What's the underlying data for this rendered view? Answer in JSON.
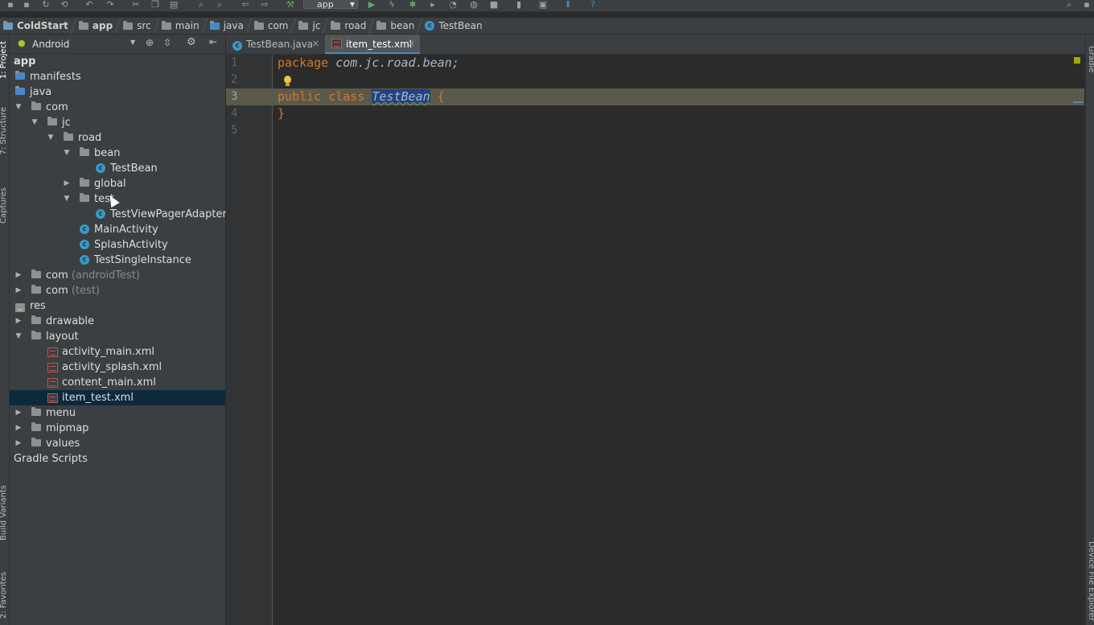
{
  "toolbar": {
    "run_config": "app"
  },
  "breadcrumb": [
    {
      "label": "ColdStart",
      "icon": "project-icon",
      "bold": true
    },
    {
      "label": "app",
      "icon": "module-folder-icon",
      "bold": true
    },
    {
      "label": "src",
      "icon": "folder-icon"
    },
    {
      "label": "main",
      "icon": "folder-icon"
    },
    {
      "label": "java",
      "icon": "source-folder-icon"
    },
    {
      "label": "com",
      "icon": "package-icon"
    },
    {
      "label": "jc",
      "icon": "package-icon"
    },
    {
      "label": "road",
      "icon": "package-icon"
    },
    {
      "label": "bean",
      "icon": "package-icon"
    },
    {
      "label": "TestBean",
      "icon": "class-icon"
    }
  ],
  "project_panel": {
    "view_mode": "Android"
  },
  "tree": [
    {
      "label": "app",
      "sub": ""
    },
    {
      "label": "manifests",
      "sub": ""
    },
    {
      "label": "java",
      "sub": ""
    },
    {
      "label": "com",
      "sub": ""
    },
    {
      "label": "jc",
      "sub": ""
    },
    {
      "label": "road",
      "sub": ""
    },
    {
      "label": "bean",
      "sub": ""
    },
    {
      "label": "TestBean",
      "sub": ""
    },
    {
      "label": "global",
      "sub": ""
    },
    {
      "label": "test",
      "sub": ""
    },
    {
      "label": "TestViewPagerAdapter",
      "sub": ""
    },
    {
      "label": "MainActivity",
      "sub": ""
    },
    {
      "label": "SplashActivity",
      "sub": ""
    },
    {
      "label": "TestSingleInstance",
      "sub": ""
    },
    {
      "label": "com",
      "sub": "(androidTest)"
    },
    {
      "label": "com",
      "sub": "(test)"
    },
    {
      "label": "res",
      "sub": ""
    },
    {
      "label": "drawable",
      "sub": ""
    },
    {
      "label": "layout",
      "sub": ""
    },
    {
      "label": "activity_main.xml",
      "sub": ""
    },
    {
      "label": "activity_splash.xml",
      "sub": ""
    },
    {
      "label": "content_main.xml",
      "sub": ""
    },
    {
      "label": "item_test.xml",
      "sub": ""
    },
    {
      "label": "menu",
      "sub": ""
    },
    {
      "label": "mipmap",
      "sub": ""
    },
    {
      "label": "values",
      "sub": ""
    },
    {
      "label": "Gradle Scripts",
      "sub": ""
    }
  ],
  "tabs": [
    {
      "label": "TestBean.java",
      "icon": "class-icon",
      "active": false
    },
    {
      "label": "item_test.xml",
      "icon": "xml-file-icon",
      "active": true
    }
  ],
  "editor": {
    "line_numbers": [
      "1",
      "2",
      "3",
      "4",
      "5"
    ],
    "line1": {
      "keyword": "package",
      "rest": "com.jc.road.bean;"
    },
    "line3": {
      "kw1": "public",
      "kw2": "class",
      "name": "TestBean",
      "brace": "{"
    },
    "line4": "}"
  },
  "side_tabs": {
    "left": [
      "1: Project",
      "7: Structure",
      "Captures",
      "Build Variants",
      "2: Favorites"
    ],
    "right": [
      "Gradle",
      "Device File Explorer"
    ]
  }
}
